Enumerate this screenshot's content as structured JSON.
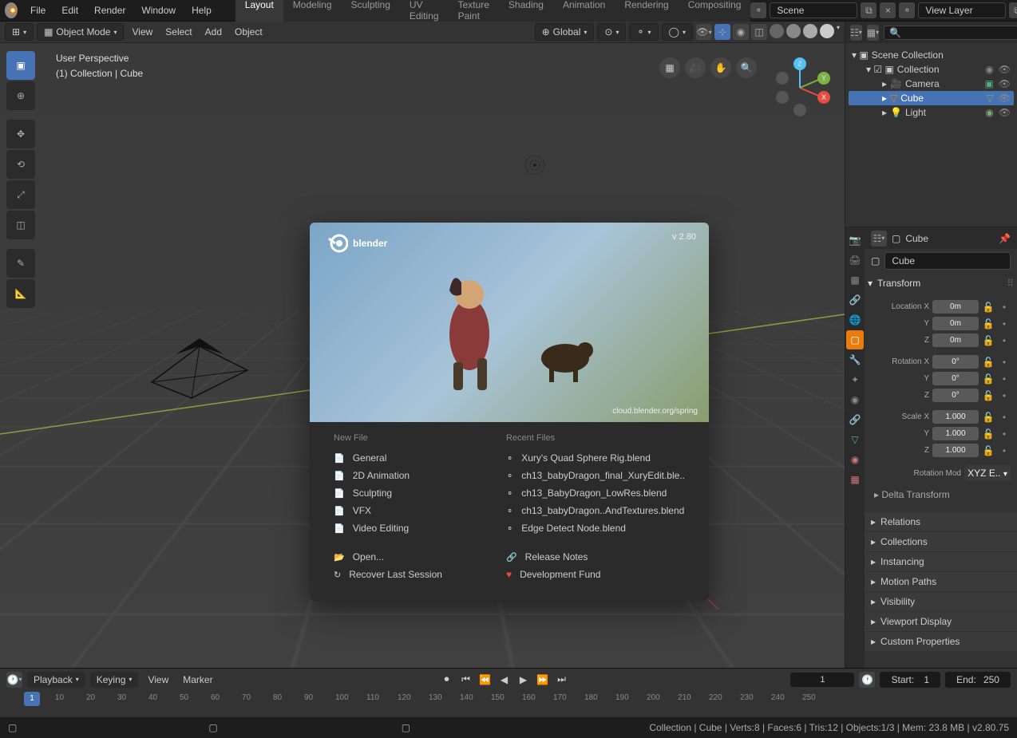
{
  "topmenu": [
    "File",
    "Edit",
    "Render",
    "Window",
    "Help"
  ],
  "workspaces": [
    "Layout",
    "Modeling",
    "Sculpting",
    "UV Editing",
    "Texture Paint",
    "Shading",
    "Animation",
    "Rendering",
    "Compositing"
  ],
  "scene_label": "Scene",
  "viewlayer_label": "View Layer",
  "viewport_header": {
    "mode": "Object Mode",
    "menus": [
      "View",
      "Select",
      "Add",
      "Object"
    ],
    "orientation": "Global"
  },
  "overlay": {
    "line1": "User Perspective",
    "line2": "(1) Collection | Cube"
  },
  "axes": {
    "x": "X",
    "y": "Y",
    "z": "Z"
  },
  "splash": {
    "brand": "blender",
    "version": "v 2.80",
    "credit": "cloud.blender.org/spring",
    "newfile_head": "New File",
    "newfile": [
      "General",
      "2D Animation",
      "Sculpting",
      "VFX",
      "Video Editing"
    ],
    "open": "Open...",
    "recover": "Recover Last Session",
    "recent_head": "Recent Files",
    "recent": [
      "Xury's Quad Sphere Rig.blend",
      "ch13_babyDragon_final_XuryEdit.ble..",
      "ch13_BabyDragon_LowRes.blend",
      "ch13_babyDragon..AndTextures.blend",
      "Edge Detect Node.blend"
    ],
    "release": "Release Notes",
    "fund": "Development Fund"
  },
  "outliner": {
    "root": "Scene Collection",
    "collection": "Collection",
    "items": [
      "Camera",
      "Cube",
      "Light"
    ]
  },
  "props": {
    "objname": "Cube",
    "breadcrumb": "Cube",
    "transform": "Transform",
    "location": "Location X",
    "loc": [
      "0m",
      "0m",
      "0m"
    ],
    "rotation": "Rotation X",
    "rot": [
      "0°",
      "0°",
      "0°"
    ],
    "scale": "Scale X",
    "scl": [
      "1.000",
      "1.000",
      "1.000"
    ],
    "yz": [
      "Y",
      "Z"
    ],
    "rotmode_label": "Rotation Mod",
    "rotmode": "XYZ E.. ",
    "delta": "Delta Transform",
    "panels": [
      "Relations",
      "Collections",
      "Instancing",
      "Motion Paths",
      "Visibility",
      "Viewport Display",
      "Custom Properties"
    ]
  },
  "timeline": {
    "dropdowns": [
      "Playback",
      "Keying"
    ],
    "menus": [
      "View",
      "Marker"
    ],
    "current": "1",
    "start_label": "Start:",
    "start": "1",
    "end_label": "End:",
    "end": "250",
    "ticks": [
      "1",
      "10",
      "20",
      "30",
      "40",
      "50",
      "60",
      "70",
      "80",
      "90",
      "100",
      "110",
      "120",
      "130",
      "140",
      "150",
      "160",
      "170",
      "180",
      "190",
      "200",
      "210",
      "220",
      "230",
      "240",
      "250"
    ]
  },
  "status": "Collection | Cube | Verts:8 | Faces:6 | Tris:12 | Objects:1/3 | Mem: 23.8 MB | v2.80.75"
}
